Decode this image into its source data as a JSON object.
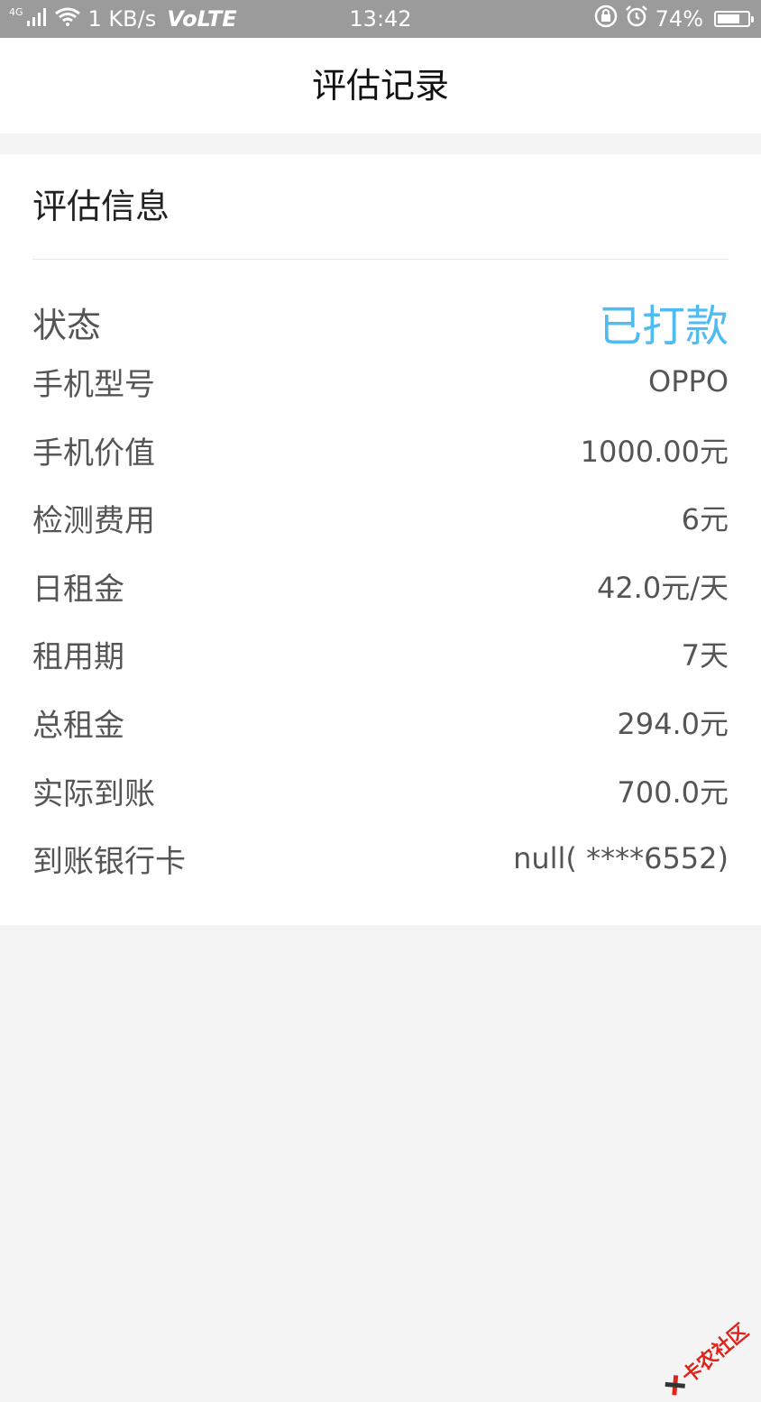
{
  "status_bar": {
    "network_type": "4G",
    "speed": "1 KB/s",
    "volte": "VoLTE",
    "time": "13:42",
    "battery_percent": "74%",
    "battery_level": 0.74
  },
  "header": {
    "title": "评估记录"
  },
  "info": {
    "section_title": "评估信息",
    "status_color": "#4fbbf0",
    "rows": [
      {
        "label": "状态",
        "value": "已打款"
      },
      {
        "label": "手机型号",
        "value": "OPPO"
      },
      {
        "label": "手机价值",
        "value": "1000.00元"
      },
      {
        "label": "检测费用",
        "value": "6元"
      },
      {
        "label": "日租金",
        "value": "42.0元/天"
      },
      {
        "label": "租用期",
        "value": "7天"
      },
      {
        "label": "总租金",
        "value": "294.0元"
      },
      {
        "label": "实际到账",
        "value": "700.0元"
      },
      {
        "label": "到账银行卡",
        "value": "null( ****6552)"
      }
    ]
  },
  "watermark": {
    "text": "卡农社区"
  }
}
